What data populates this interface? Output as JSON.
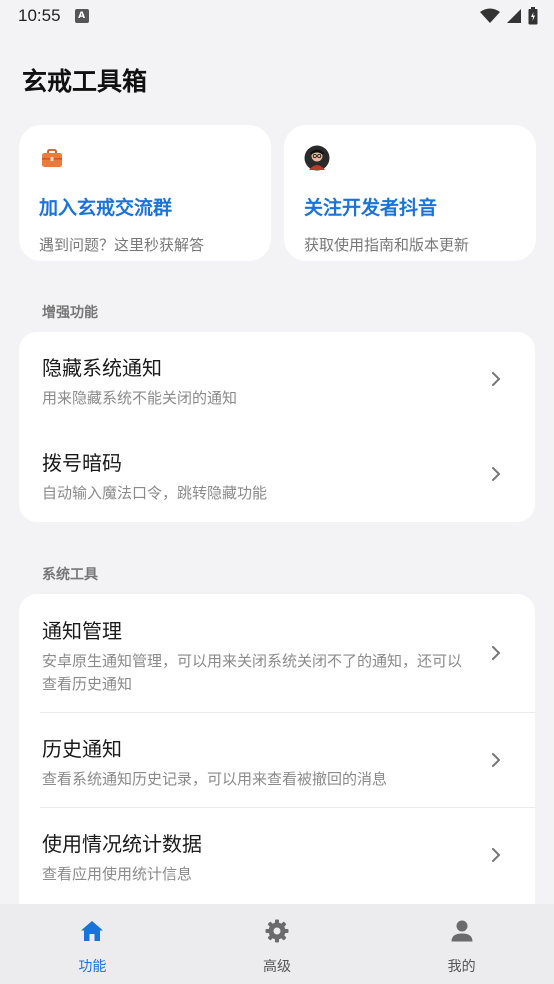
{
  "status_bar": {
    "time": "10:55",
    "notif_letter": "A"
  },
  "page": {
    "title": "玄戒工具箱"
  },
  "promo_cards": [
    {
      "title": "加入玄戒交流群",
      "subtitle": "遇到问题？这里秒获解答",
      "icon": "briefcase-icon"
    },
    {
      "title": "关注开发者抖音",
      "subtitle": "获取使用指南和版本更新",
      "icon": "developer-avatar"
    }
  ],
  "sections": {
    "enhanced": {
      "header": "增强功能",
      "items": [
        {
          "title": "隐藏系统通知",
          "desc": "用来隐藏系统不能关闭的通知"
        },
        {
          "title": "拨号暗码",
          "desc": "自动输入魔法口令，跳转隐藏功能"
        }
      ]
    },
    "system": {
      "header": "系统工具",
      "items": [
        {
          "title": "通知管理",
          "desc": "安卓原生通知管理，可以用来关闭系统关闭不了的通知，还可以查看历史通知"
        },
        {
          "title": "历史通知",
          "desc": "查看系统通知历史记录，可以用来查看被撤回的消息"
        },
        {
          "title": "使用情况统计数据",
          "desc": "查看应用使用统计信息"
        }
      ]
    }
  },
  "bottom_nav": [
    {
      "label": "功能",
      "icon": "home-icon",
      "active": true
    },
    {
      "label": "高级",
      "icon": "gear-icon",
      "active": false
    },
    {
      "label": "我的",
      "icon": "person-icon",
      "active": false
    }
  ],
  "colors": {
    "accent": "#1a73d9",
    "background": "#f3f3f5",
    "card": "#ffffff"
  }
}
